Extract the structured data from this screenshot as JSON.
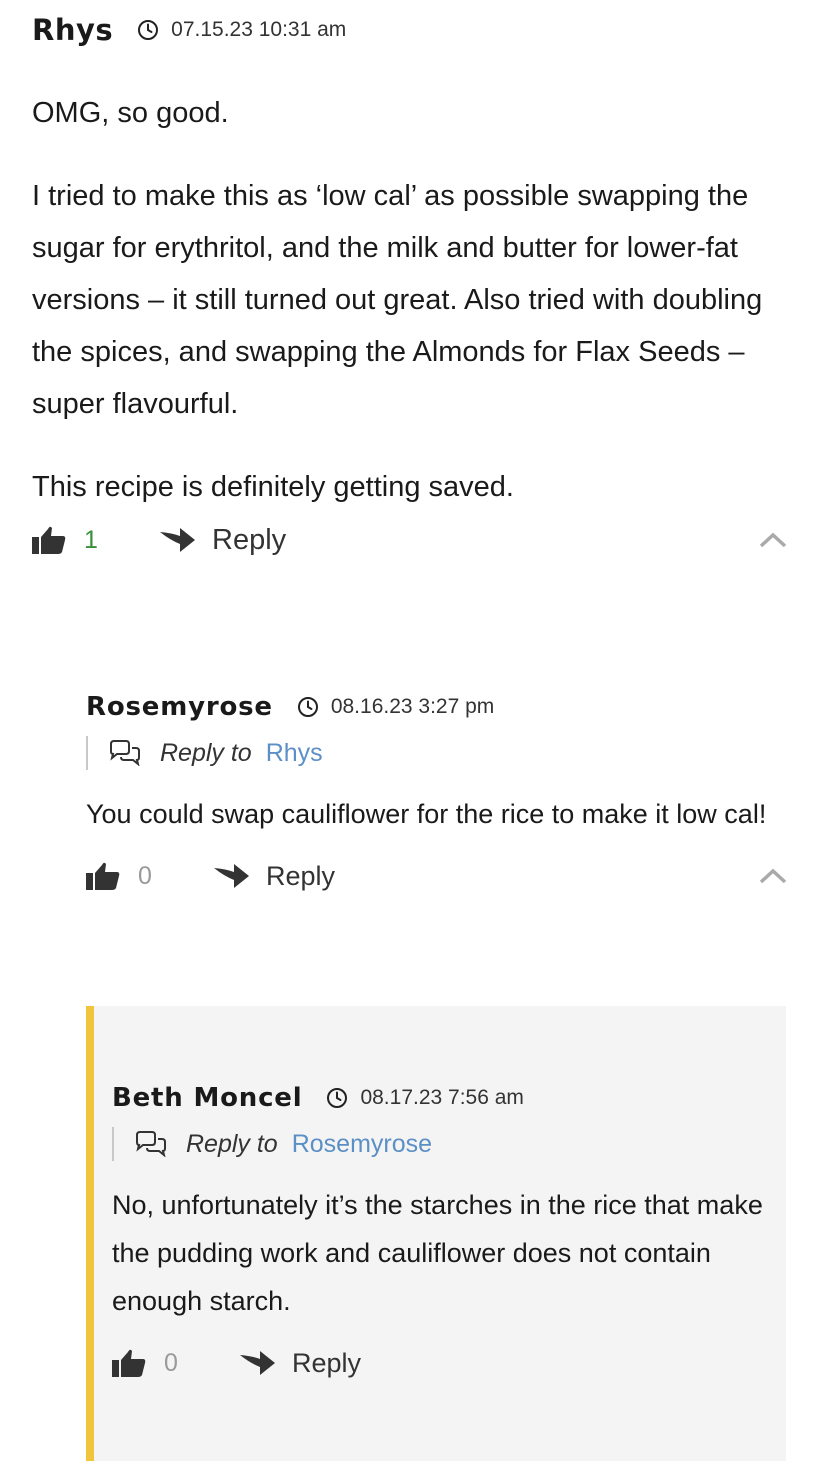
{
  "comments": [
    {
      "author": "Rhys",
      "date": "07.15.23 10:31 am",
      "paragraphs": [
        "OMG, so good.",
        "I tried to make this as ‘low cal’ as possible swapping the sugar for erythritol, and the milk and butter for lower-fat versions – it still turned out great. Also tried with doubling the spices, and swapping the Almonds for Flax Seeds – super flavourful.",
        "This recipe is definitely getting saved."
      ],
      "likes": "1",
      "reply_label": "Reply"
    },
    {
      "author": "Rosemyrose",
      "date": "08.16.23 3:27 pm",
      "reply_to_prefix": "Reply to",
      "reply_to_name": "Rhys",
      "paragraphs": [
        "You could swap cauliflower for the rice to make it low cal!"
      ],
      "likes": "0",
      "reply_label": "Reply"
    },
    {
      "author": "Beth Moncel",
      "date": "08.17.23 7:56 am",
      "reply_to_prefix": "Reply to",
      "reply_to_name": "Rosemyrose",
      "paragraphs": [
        "No, unfortunately it’s the starches in the rice that make the pudding work and cauliflower does not contain enough starch."
      ],
      "likes": "0",
      "reply_label": "Reply"
    }
  ],
  "icons": {
    "clock": "clock-icon",
    "thumb": "thumbs-up-icon",
    "reply": "reply-arrow-icon",
    "collapse": "chevron-up-icon",
    "reply_to": "speech-bubbles-icon"
  },
  "colors": {
    "like_active": "#3a8f3a",
    "link": "#5b8fc5",
    "author_highlight": "#f0c53a",
    "nested_background": "#f4f4f4"
  }
}
